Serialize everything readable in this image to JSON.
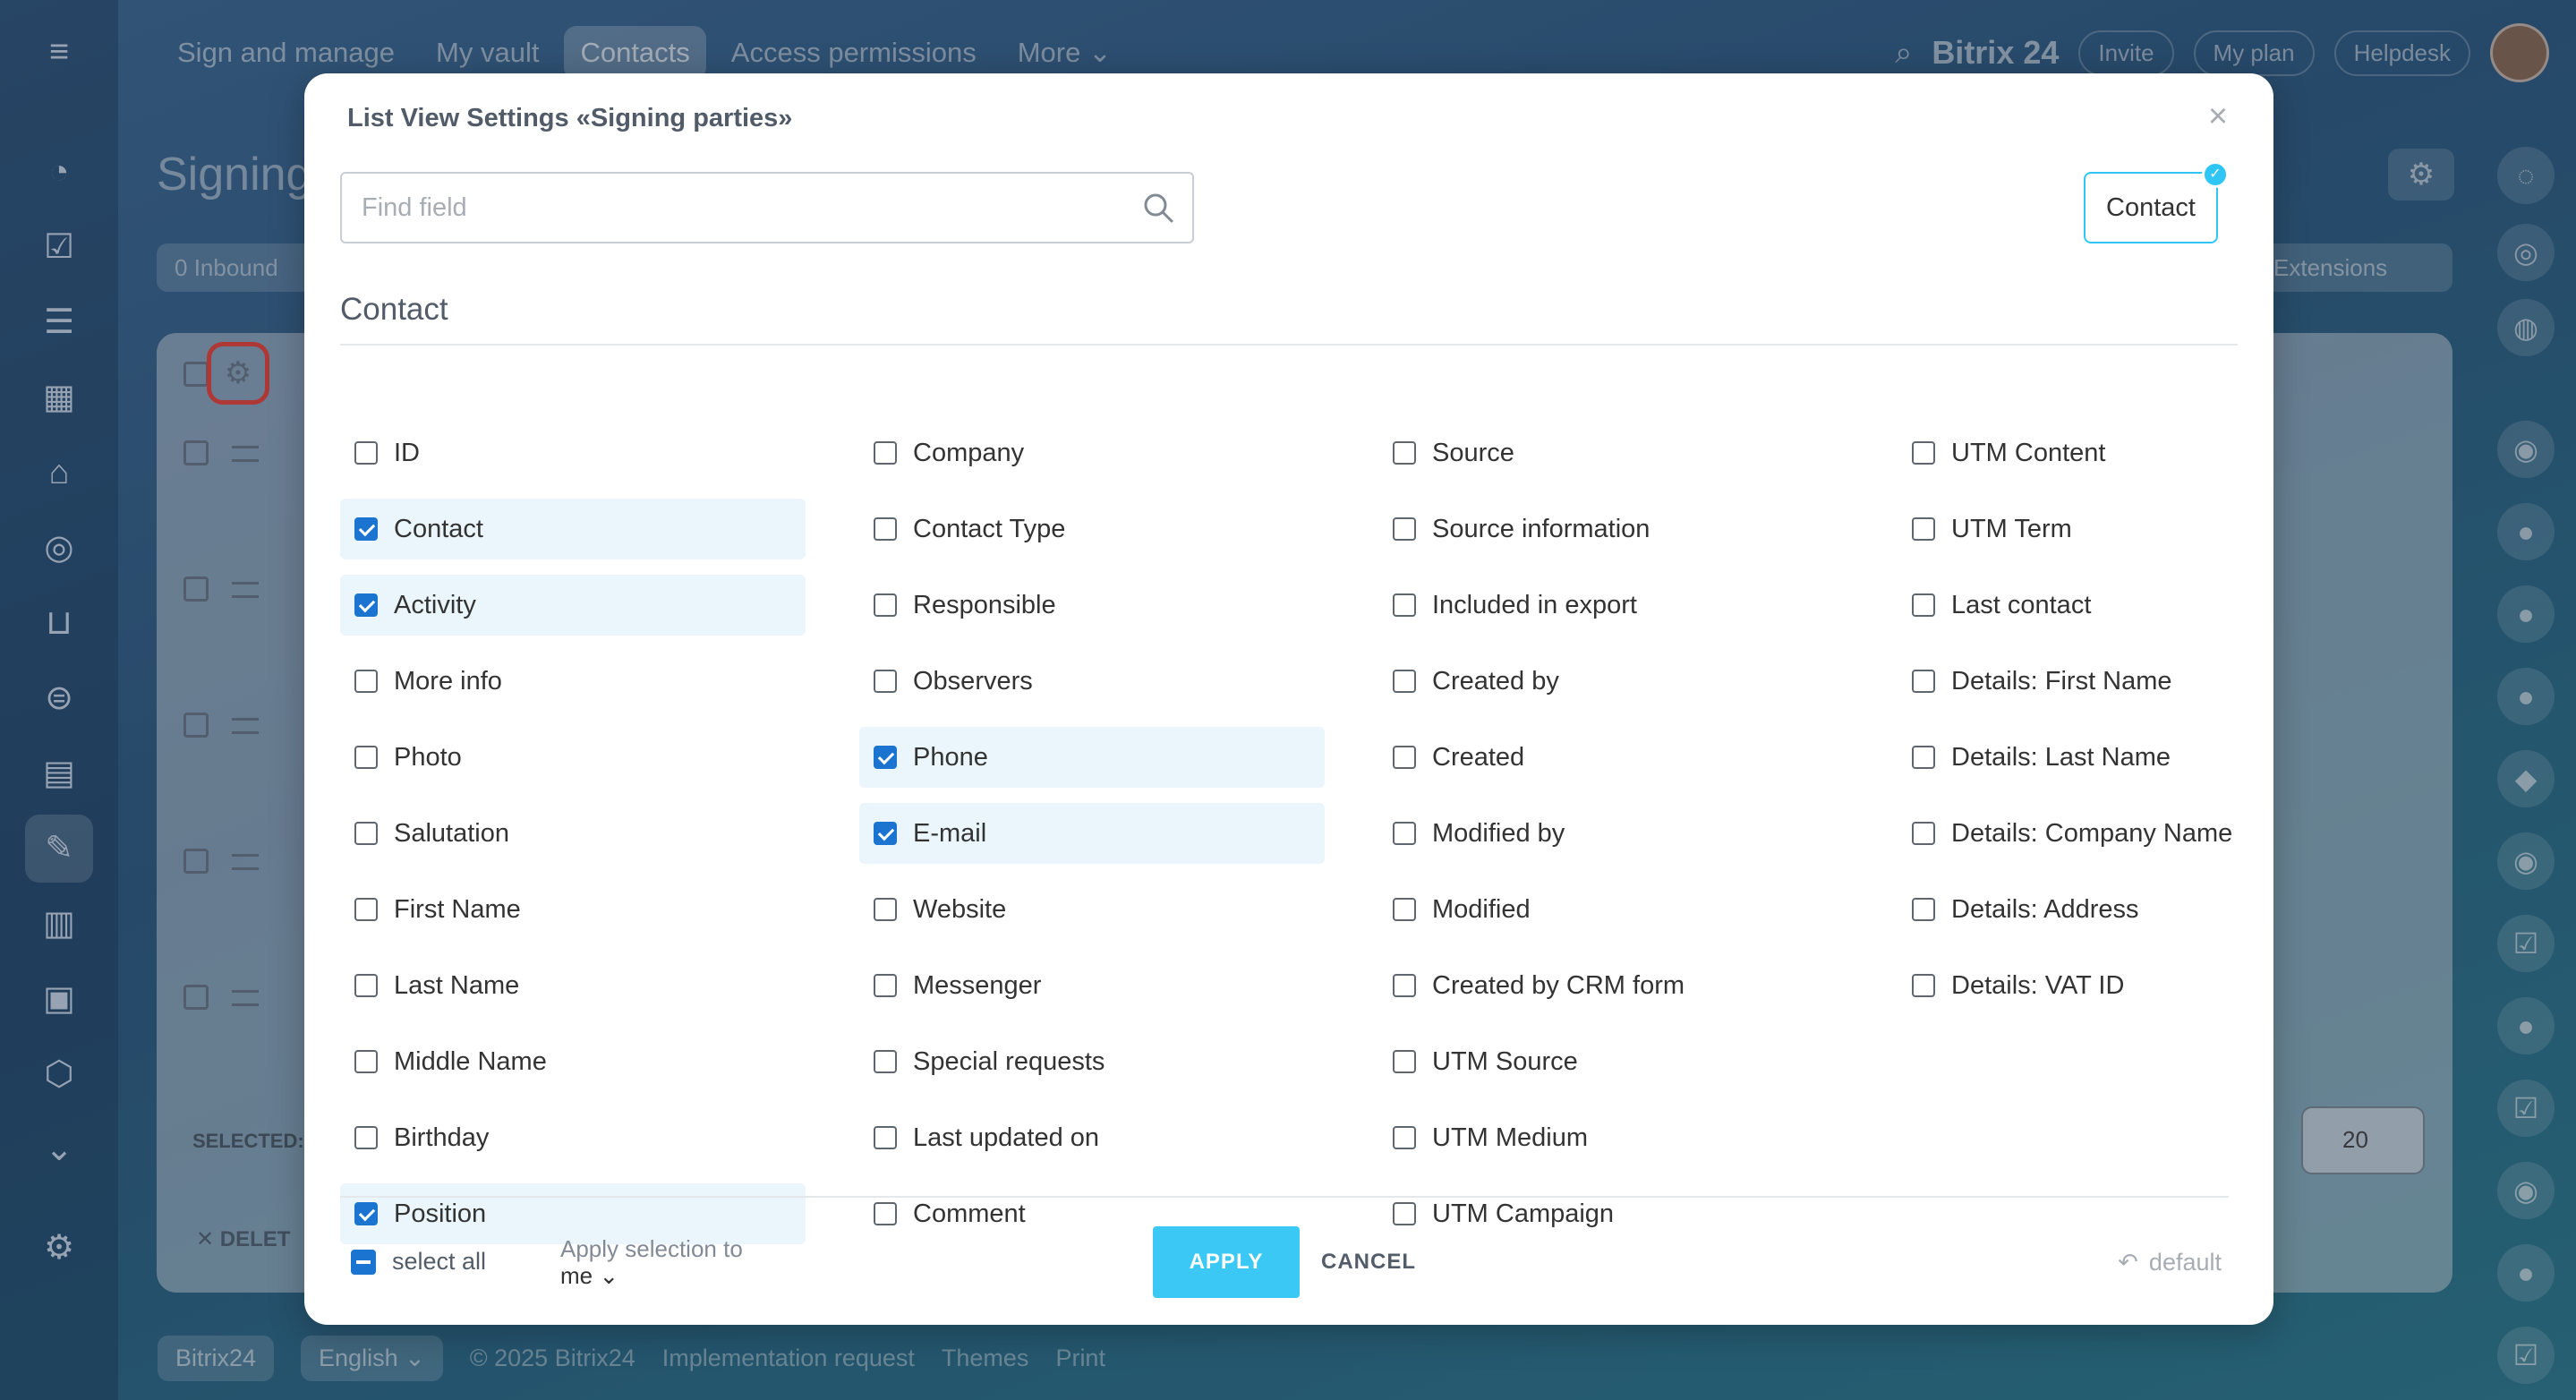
{
  "background": {
    "nav": [
      "Sign and manage",
      "My vault",
      "Contacts",
      "Access permissions",
      "More"
    ],
    "active_nav": "Contacts",
    "brand": "Bitrix 24",
    "top_buttons": [
      "Invite",
      "My plan",
      "Helpdesk"
    ],
    "page_title": "Signing",
    "inbound_count": "0",
    "inbound_label": "Inbound",
    "extensions_label": "Extensions",
    "selected_label": "SELECTED:",
    "delete_label": "DELET",
    "page_size": "20",
    "footer": {
      "brand": "Bitrix24",
      "language": "English",
      "copyright": "© 2025 Bitrix24",
      "links": [
        "Implementation request",
        "Themes",
        "Print"
      ]
    }
  },
  "modal": {
    "title": "List View Settings «Signing parties»",
    "search_placeholder": "Find field",
    "entity_tag": "Contact",
    "section_title": "Contact",
    "columns": [
      [
        {
          "label": "ID",
          "checked": false
        },
        {
          "label": "Contact",
          "checked": true
        },
        {
          "label": "Activity",
          "checked": true
        },
        {
          "label": "More info",
          "checked": false
        },
        {
          "label": "Photo",
          "checked": false
        },
        {
          "label": "Salutation",
          "checked": false
        },
        {
          "label": "First Name",
          "checked": false
        },
        {
          "label": "Last Name",
          "checked": false
        },
        {
          "label": "Middle Name",
          "checked": false
        },
        {
          "label": "Birthday",
          "checked": false
        },
        {
          "label": "Position",
          "checked": true
        }
      ],
      [
        {
          "label": "Company",
          "checked": false
        },
        {
          "label": "Contact Type",
          "checked": false
        },
        {
          "label": "Responsible",
          "checked": false
        },
        {
          "label": "Observers",
          "checked": false
        },
        {
          "label": "Phone",
          "checked": true
        },
        {
          "label": "E-mail",
          "checked": true
        },
        {
          "label": "Website",
          "checked": false
        },
        {
          "label": "Messenger",
          "checked": false
        },
        {
          "label": "Special requests",
          "checked": false
        },
        {
          "label": "Last updated on",
          "checked": false
        },
        {
          "label": "Comment",
          "checked": false
        }
      ],
      [
        {
          "label": "Source",
          "checked": false
        },
        {
          "label": "Source information",
          "checked": false
        },
        {
          "label": "Included in export",
          "checked": false
        },
        {
          "label": "Created by",
          "checked": false
        },
        {
          "label": "Created",
          "checked": false
        },
        {
          "label": "Modified by",
          "checked": false
        },
        {
          "label": "Modified",
          "checked": false
        },
        {
          "label": "Created by CRM form",
          "checked": false
        },
        {
          "label": "UTM Source",
          "checked": false
        },
        {
          "label": "UTM Medium",
          "checked": false
        },
        {
          "label": "UTM Campaign",
          "checked": false
        }
      ],
      [
        {
          "label": "UTM Content",
          "checked": false
        },
        {
          "label": "UTM Term",
          "checked": false
        },
        {
          "label": "Last contact",
          "checked": false
        },
        {
          "label": "Details: First Name",
          "checked": false
        },
        {
          "label": "Details: Last Name",
          "checked": false
        },
        {
          "label": "Details: Company Name",
          "checked": false
        },
        {
          "label": "Details: Address",
          "checked": false
        },
        {
          "label": "Details: VAT ID",
          "checked": false
        }
      ]
    ],
    "select_all_label": "select all",
    "apply_selection_label": "Apply selection to",
    "apply_selection_value": "me",
    "apply_label": "APPLY",
    "cancel_label": "CANCEL",
    "default_label": "default"
  },
  "colors": {
    "accent": "#3bc8f5",
    "checkbox_checked": "#1b75d0",
    "checked_row_bg": "#eaf6fb"
  }
}
